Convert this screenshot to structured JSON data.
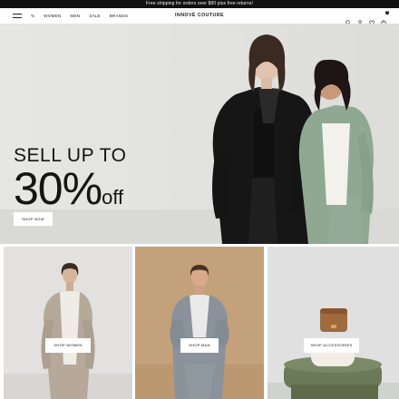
{
  "announcement": "Free shipping for orders over $80 plus free returns!",
  "header": {
    "logo": "INNOVÉ COUTURE",
    "nav": [
      "%",
      "WOMEN",
      "MEN",
      "SALE",
      "BRANDS"
    ],
    "icons": [
      "menu-icon",
      "search-icon",
      "account-icon",
      "wishlist-icon",
      "cart-icon"
    ],
    "cart_count": "0"
  },
  "hero": {
    "line1": "SELL UP TO",
    "line2_number": "30%",
    "line2_suffix": "off",
    "button": "SHOP NOW"
  },
  "tiles": [
    {
      "button": "SHOP WOMEN"
    },
    {
      "button": "SHOP MAN"
    },
    {
      "button": "SHOP ACCESSORIES"
    }
  ],
  "colors": {
    "announcement_bg": "#111111",
    "hero_bg": "#e4e4e2",
    "men_tile_bg": "#c2a07a",
    "jacket_green": "#8fa892"
  }
}
